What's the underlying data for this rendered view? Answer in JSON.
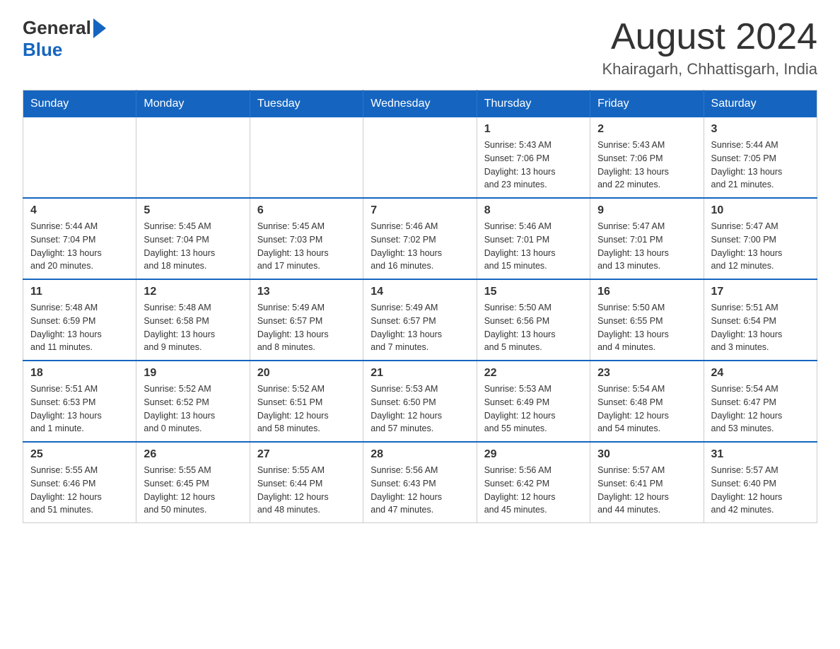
{
  "header": {
    "title": "August 2024",
    "subtitle": "Khairagarh, Chhattisgarh, India",
    "logo_general": "General",
    "logo_blue": "Blue"
  },
  "days_of_week": [
    "Sunday",
    "Monday",
    "Tuesday",
    "Wednesday",
    "Thursday",
    "Friday",
    "Saturday"
  ],
  "weeks": [
    [
      {
        "day": "",
        "info": ""
      },
      {
        "day": "",
        "info": ""
      },
      {
        "day": "",
        "info": ""
      },
      {
        "day": "",
        "info": ""
      },
      {
        "day": "1",
        "info": "Sunrise: 5:43 AM\nSunset: 7:06 PM\nDaylight: 13 hours\nand 23 minutes."
      },
      {
        "day": "2",
        "info": "Sunrise: 5:43 AM\nSunset: 7:06 PM\nDaylight: 13 hours\nand 22 minutes."
      },
      {
        "day": "3",
        "info": "Sunrise: 5:44 AM\nSunset: 7:05 PM\nDaylight: 13 hours\nand 21 minutes."
      }
    ],
    [
      {
        "day": "4",
        "info": "Sunrise: 5:44 AM\nSunset: 7:04 PM\nDaylight: 13 hours\nand 20 minutes."
      },
      {
        "day": "5",
        "info": "Sunrise: 5:45 AM\nSunset: 7:04 PM\nDaylight: 13 hours\nand 18 minutes."
      },
      {
        "day": "6",
        "info": "Sunrise: 5:45 AM\nSunset: 7:03 PM\nDaylight: 13 hours\nand 17 minutes."
      },
      {
        "day": "7",
        "info": "Sunrise: 5:46 AM\nSunset: 7:02 PM\nDaylight: 13 hours\nand 16 minutes."
      },
      {
        "day": "8",
        "info": "Sunrise: 5:46 AM\nSunset: 7:01 PM\nDaylight: 13 hours\nand 15 minutes."
      },
      {
        "day": "9",
        "info": "Sunrise: 5:47 AM\nSunset: 7:01 PM\nDaylight: 13 hours\nand 13 minutes."
      },
      {
        "day": "10",
        "info": "Sunrise: 5:47 AM\nSunset: 7:00 PM\nDaylight: 13 hours\nand 12 minutes."
      }
    ],
    [
      {
        "day": "11",
        "info": "Sunrise: 5:48 AM\nSunset: 6:59 PM\nDaylight: 13 hours\nand 11 minutes."
      },
      {
        "day": "12",
        "info": "Sunrise: 5:48 AM\nSunset: 6:58 PM\nDaylight: 13 hours\nand 9 minutes."
      },
      {
        "day": "13",
        "info": "Sunrise: 5:49 AM\nSunset: 6:57 PM\nDaylight: 13 hours\nand 8 minutes."
      },
      {
        "day": "14",
        "info": "Sunrise: 5:49 AM\nSunset: 6:57 PM\nDaylight: 13 hours\nand 7 minutes."
      },
      {
        "day": "15",
        "info": "Sunrise: 5:50 AM\nSunset: 6:56 PM\nDaylight: 13 hours\nand 5 minutes."
      },
      {
        "day": "16",
        "info": "Sunrise: 5:50 AM\nSunset: 6:55 PM\nDaylight: 13 hours\nand 4 minutes."
      },
      {
        "day": "17",
        "info": "Sunrise: 5:51 AM\nSunset: 6:54 PM\nDaylight: 13 hours\nand 3 minutes."
      }
    ],
    [
      {
        "day": "18",
        "info": "Sunrise: 5:51 AM\nSunset: 6:53 PM\nDaylight: 13 hours\nand 1 minute."
      },
      {
        "day": "19",
        "info": "Sunrise: 5:52 AM\nSunset: 6:52 PM\nDaylight: 13 hours\nand 0 minutes."
      },
      {
        "day": "20",
        "info": "Sunrise: 5:52 AM\nSunset: 6:51 PM\nDaylight: 12 hours\nand 58 minutes."
      },
      {
        "day": "21",
        "info": "Sunrise: 5:53 AM\nSunset: 6:50 PM\nDaylight: 12 hours\nand 57 minutes."
      },
      {
        "day": "22",
        "info": "Sunrise: 5:53 AM\nSunset: 6:49 PM\nDaylight: 12 hours\nand 55 minutes."
      },
      {
        "day": "23",
        "info": "Sunrise: 5:54 AM\nSunset: 6:48 PM\nDaylight: 12 hours\nand 54 minutes."
      },
      {
        "day": "24",
        "info": "Sunrise: 5:54 AM\nSunset: 6:47 PM\nDaylight: 12 hours\nand 53 minutes."
      }
    ],
    [
      {
        "day": "25",
        "info": "Sunrise: 5:55 AM\nSunset: 6:46 PM\nDaylight: 12 hours\nand 51 minutes."
      },
      {
        "day": "26",
        "info": "Sunrise: 5:55 AM\nSunset: 6:45 PM\nDaylight: 12 hours\nand 50 minutes."
      },
      {
        "day": "27",
        "info": "Sunrise: 5:55 AM\nSunset: 6:44 PM\nDaylight: 12 hours\nand 48 minutes."
      },
      {
        "day": "28",
        "info": "Sunrise: 5:56 AM\nSunset: 6:43 PM\nDaylight: 12 hours\nand 47 minutes."
      },
      {
        "day": "29",
        "info": "Sunrise: 5:56 AM\nSunset: 6:42 PM\nDaylight: 12 hours\nand 45 minutes."
      },
      {
        "day": "30",
        "info": "Sunrise: 5:57 AM\nSunset: 6:41 PM\nDaylight: 12 hours\nand 44 minutes."
      },
      {
        "day": "31",
        "info": "Sunrise: 5:57 AM\nSunset: 6:40 PM\nDaylight: 12 hours\nand 42 minutes."
      }
    ]
  ]
}
